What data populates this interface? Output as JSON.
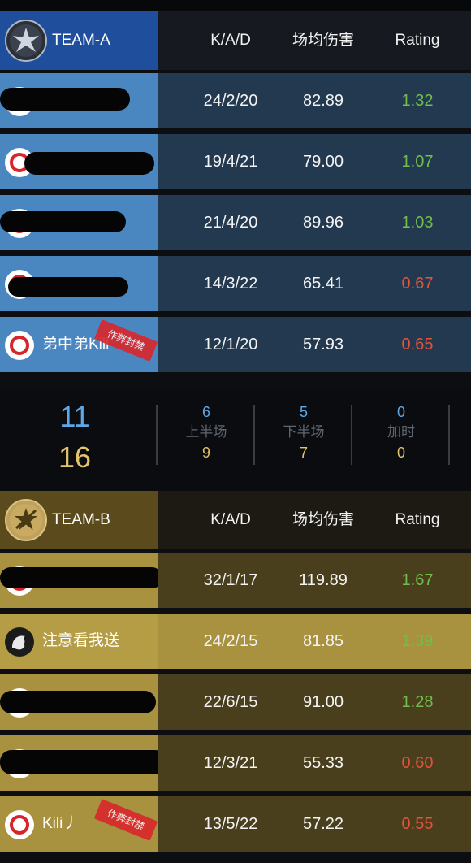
{
  "columns": {
    "kad": "K/A/D",
    "damage": "场均伤害",
    "rating": "Rating"
  },
  "colors": {
    "good": "#6fbf4a",
    "bad": "#e2533b",
    "team_a_blue": "#2f5fae",
    "team_b_gold": "#a8913f"
  },
  "team_a": {
    "name": "TEAM-A",
    "icon": "ct-emblem-icon",
    "players": [
      {
        "name": "",
        "kad": "24/2/20",
        "damage": "82.89",
        "rating": "1.32"
      },
      {
        "name": "",
        "kad": "19/4/21",
        "damage": "79.00",
        "rating": "1.07"
      },
      {
        "name": "",
        "kad": "21/4/20",
        "damage": "89.96",
        "rating": "1.03"
      },
      {
        "name": "",
        "kad": "14/3/22",
        "damage": "65.41",
        "rating": "0.67"
      },
      {
        "name": "弟中弟Kill",
        "kad": "12/1/20",
        "damage": "57.93",
        "rating": "0.65",
        "stamp": "作弊封禁"
      }
    ]
  },
  "score": {
    "team_a_total": "11",
    "team_b_total": "16",
    "halves": [
      {
        "label": "上半场",
        "a": "6",
        "b": "9"
      },
      {
        "label": "下半场",
        "a": "5",
        "b": "7"
      },
      {
        "label": "加时",
        "a": "0",
        "b": "0"
      }
    ]
  },
  "team_b": {
    "name": "TEAM-B",
    "icon": "t-emblem-icon",
    "players": [
      {
        "name": "...",
        "kad": "32/1/17",
        "damage": "119.89",
        "rating": "1.67"
      },
      {
        "name": "注意看我送",
        "kad": "24/2/15",
        "damage": "81.85",
        "rating": "1.39"
      },
      {
        "name": "",
        "kad": "22/6/15",
        "damage": "91.00",
        "rating": "1.28"
      },
      {
        "name": "",
        "kad": "12/3/21",
        "damage": "55.33",
        "rating": "0.60"
      },
      {
        "name": "Kili丿",
        "kad": "13/5/22",
        "damage": "57.22",
        "rating": "0.55",
        "stamp": "作弊封禁"
      }
    ]
  }
}
